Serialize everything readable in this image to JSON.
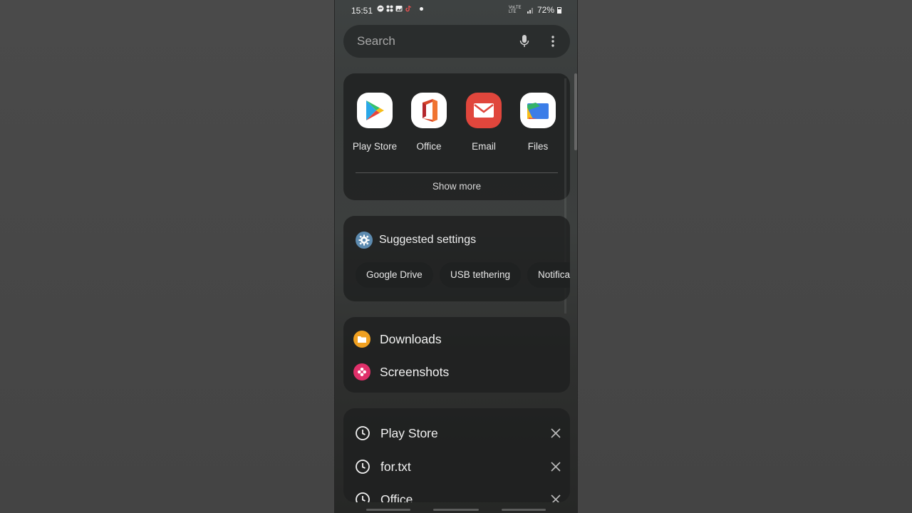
{
  "status_bar": {
    "time": "15:51",
    "network": "VoLTE LTE",
    "battery": "72%"
  },
  "search": {
    "placeholder": "Search"
  },
  "apps": {
    "items": [
      {
        "label": "Play Store",
        "icon": "play-store-icon"
      },
      {
        "label": "Office",
        "icon": "office-icon"
      },
      {
        "label": "Email",
        "icon": "email-icon"
      },
      {
        "label": "Files",
        "icon": "files-icon"
      }
    ],
    "show_more": "Show more"
  },
  "suggested_settings": {
    "title": "Suggested settings",
    "chips": [
      "Google Drive",
      "USB tethering",
      "Notifications"
    ]
  },
  "folders": {
    "items": [
      {
        "label": "Downloads",
        "icon": "downloads-folder-icon",
        "color": "#f0a020"
      },
      {
        "label": "Screenshots",
        "icon": "screenshots-flower-icon",
        "color": "#e0306a"
      }
    ]
  },
  "recent_searches": {
    "items": [
      {
        "label": "Play Store"
      },
      {
        "label": "for.txt"
      },
      {
        "label": "Office"
      }
    ]
  },
  "colors": {
    "email_red": "#e0463c",
    "settings_blue": "#5d8bb0",
    "card_bg": "#1e2020"
  }
}
